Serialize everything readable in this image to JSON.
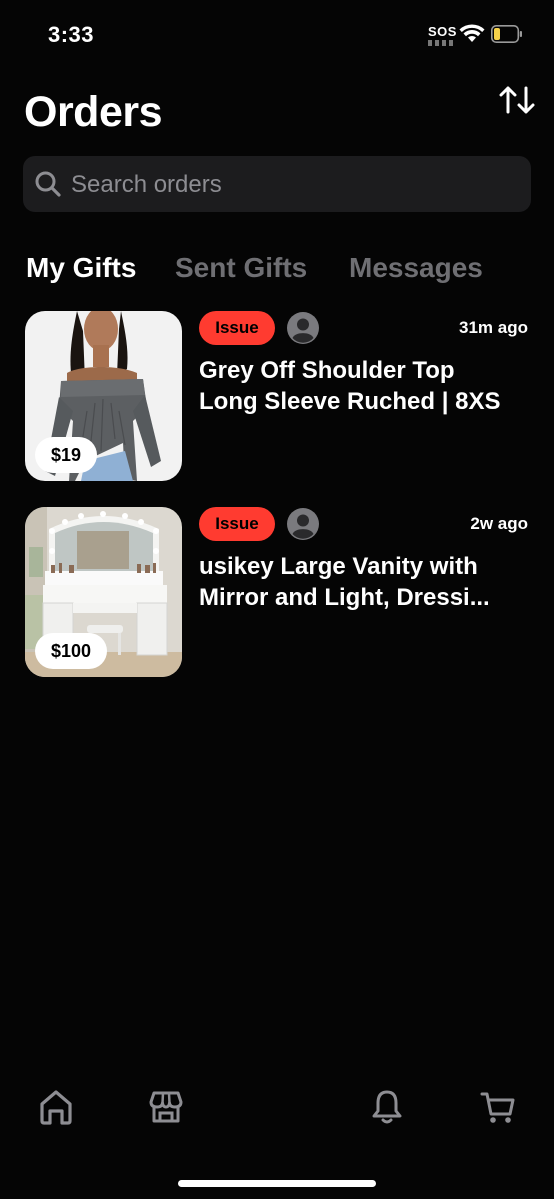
{
  "status_bar": {
    "time": "3:33",
    "sos": "SOS",
    "icons": [
      "cellular-dots",
      "wifi-icon",
      "battery-icon"
    ],
    "battery_color": "#f6d24a"
  },
  "header": {
    "title": "Orders",
    "sort_icon": "sort-arrows-icon"
  },
  "search": {
    "placeholder": "Search orders",
    "icon": "search-icon"
  },
  "tabs": [
    {
      "label": "My Gifts",
      "active": true
    },
    {
      "label": "Sent Gifts",
      "active": false
    },
    {
      "label": "Messages",
      "active": false
    }
  ],
  "orders": [
    {
      "price": "$19",
      "status": "Issue",
      "time_ago": "31m ago",
      "name_line1": "Grey Off Shoulder Top",
      "name_line2": "Long Sleeve Ruched | 8XS",
      "image": "grey off-shoulder top product photo"
    },
    {
      "price": "$100",
      "status": "Issue",
      "time_ago": "2w ago",
      "name_line1": "usikey Large Vanity with",
      "name_line2": "Mirror and Light, Dressi...",
      "image": "white vanity with lighted mirror product photo"
    }
  ],
  "colors": {
    "background": "#050505",
    "status_badge": "#ff3b30",
    "inactive_tab": "#6f6f73",
    "search_bg": "#1c1c1e"
  },
  "bottom_nav": [
    {
      "icon": "home-icon"
    },
    {
      "icon": "store-icon"
    },
    {
      "icon": "bell-icon"
    },
    {
      "icon": "cart-icon"
    }
  ]
}
